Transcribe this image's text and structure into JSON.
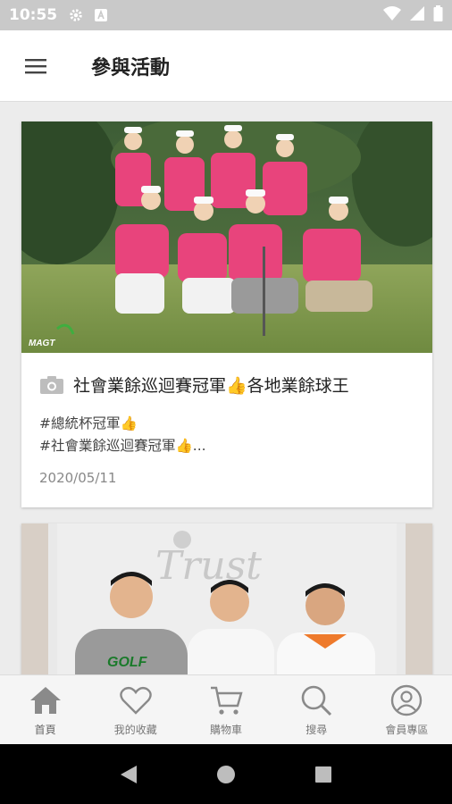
{
  "status": {
    "time": "10:55"
  },
  "appbar": {
    "title": "參與活動"
  },
  "cards": [
    {
      "title": "社會業餘巡迴賽冠軍👍各地業餘球王",
      "desc_line1": "#總統杯冠軍👍",
      "desc_line2": "#社會業餘巡迴賽冠軍👍...",
      "date": "2020/05/11"
    }
  ],
  "bottom_nav": [
    {
      "label": "首頁",
      "icon": "home-icon"
    },
    {
      "label": "我的收藏",
      "icon": "heart-icon"
    },
    {
      "label": "購物車",
      "icon": "cart-icon"
    },
    {
      "label": "搜尋",
      "icon": "search-icon"
    },
    {
      "label": "會員專區",
      "icon": "user-icon"
    }
  ],
  "colors": {
    "accent_pink": "#e85a8c",
    "nav_icon": "#8a8a8a",
    "status_bar": "#c9c9c9"
  }
}
